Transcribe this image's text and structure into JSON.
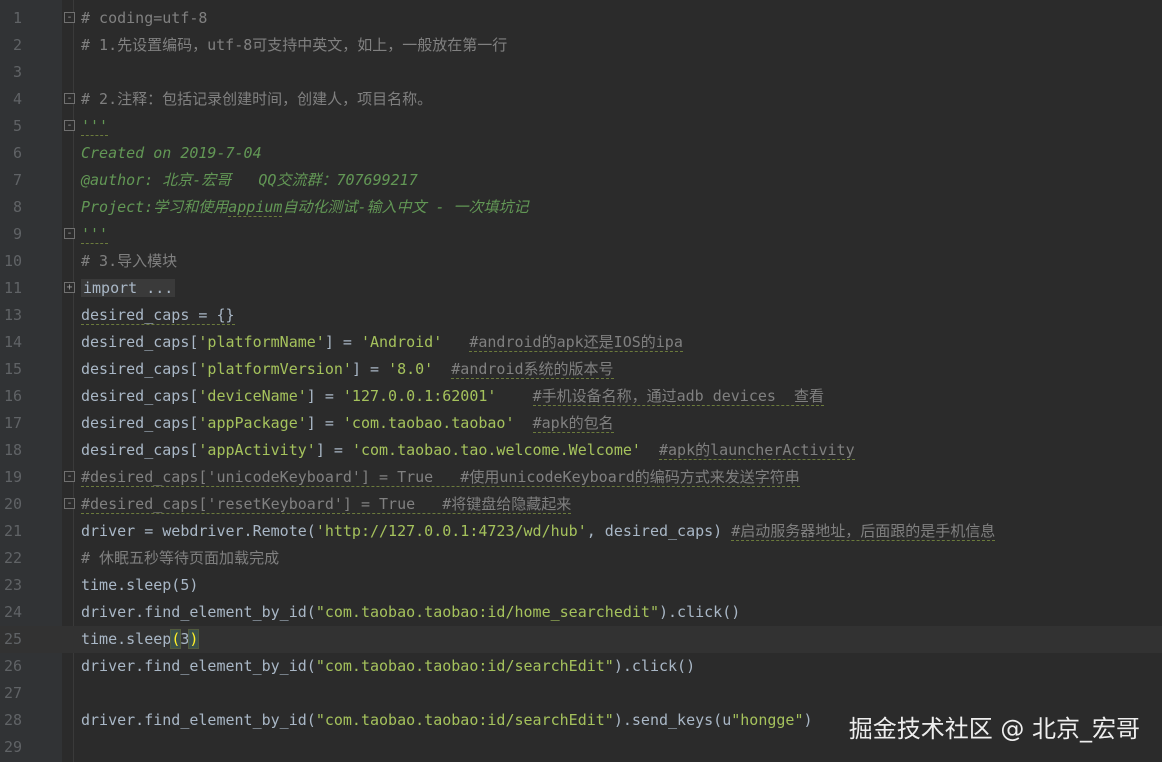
{
  "editor": {
    "lines": [
      {
        "num": "1",
        "fold": "-",
        "segs": [
          {
            "t": "# coding=utf-8",
            "c": "cmt"
          }
        ]
      },
      {
        "num": "2",
        "segs": [
          {
            "t": "# 1.先设置编码，utf-8可支持中英文，如上，一般放在第一行",
            "c": "cmt"
          }
        ]
      },
      {
        "num": "3",
        "segs": []
      },
      {
        "num": "4",
        "fold": "-",
        "segs": [
          {
            "t": "# 2.注释：包括记录创建时间，创建人，项目名称。",
            "c": "cmt"
          }
        ]
      },
      {
        "num": "5",
        "fold": "-",
        "segs": [
          {
            "t": "'''",
            "c": "doc sq"
          }
        ]
      },
      {
        "num": "6",
        "segs": [
          {
            "t": "Created on 2019-7-04",
            "c": "doc"
          }
        ]
      },
      {
        "num": "7",
        "segs": [
          {
            "t": "@author: 北京-宏哥   QQ交流群：707699217",
            "c": "doc"
          }
        ]
      },
      {
        "num": "8",
        "segs": [
          {
            "t": "Project:学习和使用",
            "c": "doc"
          },
          {
            "t": "appium",
            "c": "doc sq"
          },
          {
            "t": "自动化测试-输入中文 - 一次填坑记",
            "c": "doc"
          }
        ]
      },
      {
        "num": "9",
        "fold": "-",
        "segs": [
          {
            "t": "'''",
            "c": "doc sq"
          }
        ]
      },
      {
        "num": "10",
        "segs": [
          {
            "t": "# 3.导入模块",
            "c": "cmt"
          }
        ]
      },
      {
        "num": "11",
        "fold": "+",
        "segs": [
          {
            "t": "import ...",
            "c": "folded"
          }
        ]
      },
      {
        "num": "13",
        "segs": [
          {
            "t": "desired_caps = {}",
            "c": "sq"
          }
        ]
      },
      {
        "num": "14",
        "segs": [
          {
            "t": "desired_caps["
          },
          {
            "t": "'platformName'",
            "c": "str"
          },
          {
            "t": "] = "
          },
          {
            "t": "'Android'",
            "c": "str"
          },
          {
            "t": "   "
          },
          {
            "t": "#android的apk还是IOS的ipa",
            "c": "cmt sq"
          }
        ]
      },
      {
        "num": "15",
        "segs": [
          {
            "t": "desired_caps["
          },
          {
            "t": "'platformVersion'",
            "c": "str"
          },
          {
            "t": "] = "
          },
          {
            "t": "'8.0'",
            "c": "str"
          },
          {
            "t": "  "
          },
          {
            "t": "#android系统的版本号",
            "c": "cmt sq"
          }
        ]
      },
      {
        "num": "16",
        "segs": [
          {
            "t": "desired_caps["
          },
          {
            "t": "'deviceName'",
            "c": "str"
          },
          {
            "t": "] = "
          },
          {
            "t": "'127.0.0.1:62001'",
            "c": "str"
          },
          {
            "t": "    "
          },
          {
            "t": "#手机设备名称，通过adb devices  查看",
            "c": "cmt sq"
          }
        ]
      },
      {
        "num": "17",
        "segs": [
          {
            "t": "desired_caps["
          },
          {
            "t": "'appPackage'",
            "c": "str"
          },
          {
            "t": "] = "
          },
          {
            "t": "'com.taobao.taobao'",
            "c": "str"
          },
          {
            "t": "  "
          },
          {
            "t": "#apk的包名",
            "c": "cmt sq"
          }
        ]
      },
      {
        "num": "18",
        "segs": [
          {
            "t": "desired_caps["
          },
          {
            "t": "'appActivity'",
            "c": "str"
          },
          {
            "t": "] = "
          },
          {
            "t": "'com.taobao.tao.welcome.Welcome'",
            "c": "str"
          },
          {
            "t": "  "
          },
          {
            "t": "#apk的launcherActivity",
            "c": "cmt sq"
          }
        ]
      },
      {
        "num": "19",
        "fold": "-",
        "segs": [
          {
            "t": "#desired_caps['unicodeKeyboard'] = True   #使用unicodeKeyboard的编码方式来发送字符串",
            "c": "cmt sq"
          }
        ]
      },
      {
        "num": "20",
        "fold": "-",
        "segs": [
          {
            "t": "#desired_caps['resetKeyboard'] = True   #将键盘给隐藏起来",
            "c": "cmt sq"
          }
        ]
      },
      {
        "num": "21",
        "segs": [
          {
            "t": "driver = webdriver.Remote("
          },
          {
            "t": "'http://127.0.0.1:4723/wd/hub'",
            "c": "str"
          },
          {
            "t": ", desired_caps) "
          },
          {
            "t": "#启动服务器地址，后面跟的是手机信息",
            "c": "cmt sq"
          }
        ]
      },
      {
        "num": "22",
        "segs": [
          {
            "t": "# 休眠五秒等待页面加载完成",
            "c": "cmt"
          }
        ]
      },
      {
        "num": "23",
        "segs": [
          {
            "t": "time.sleep(5)"
          }
        ]
      },
      {
        "num": "24",
        "segs": [
          {
            "t": "driver.find_element_by_id("
          },
          {
            "t": "\"com.taobao.taobao:id/home_searchedit\"",
            "c": "str"
          },
          {
            "t": ").click()"
          }
        ]
      },
      {
        "num": "25",
        "current": true,
        "segs": [
          {
            "t": "time.sleep"
          },
          {
            "t": "(",
            "c": "hl"
          },
          {
            "t": "3"
          },
          {
            "t": ")",
            "c": "hl"
          }
        ]
      },
      {
        "num": "26",
        "segs": [
          {
            "t": "driver.find_element_by_id("
          },
          {
            "t": "\"com.taobao.taobao:id/searchEdit\"",
            "c": "str"
          },
          {
            "t": ").click()"
          }
        ]
      },
      {
        "num": "27",
        "segs": []
      },
      {
        "num": "28",
        "segs": [
          {
            "t": "driver.find_element_by_id("
          },
          {
            "t": "\"com.taobao.taobao:id/searchEdit\"",
            "c": "str"
          },
          {
            "t": ").send_keys(u"
          },
          {
            "t": "\"hongge\"",
            "c": "str"
          },
          {
            "t": ")"
          }
        ]
      },
      {
        "num": "29",
        "segs": []
      }
    ]
  },
  "watermark": "掘金技术社区 @ 北京_宏哥",
  "colors": {
    "background": "#2b2b2b",
    "comment": "#808080",
    "docstring": "#629755",
    "string": "#a5c25c",
    "text": "#a9b7c6"
  }
}
